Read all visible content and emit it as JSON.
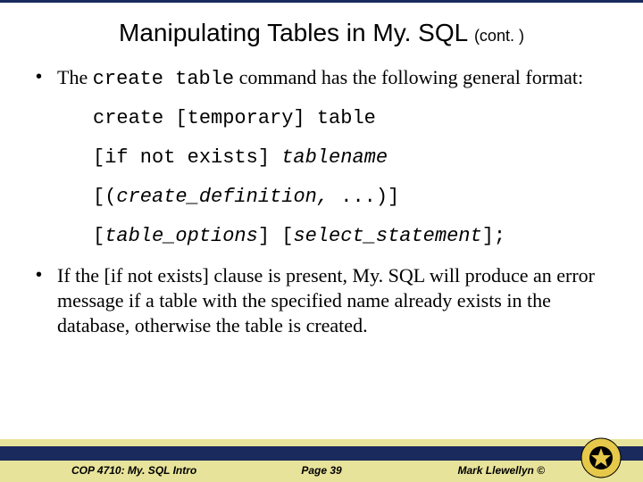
{
  "title": {
    "main": "Manipulating Tables in My. SQL ",
    "cont": "(cont. )"
  },
  "bullets": {
    "b1_pre": "The ",
    "b1_code": "create table",
    "b1_post": " command has the following general format:",
    "b2": "If the [if not exists] clause is present, My. SQL will produce an error message if a table with the specified name already exists in the database, otherwise the table is created."
  },
  "code": {
    "l1a": "create [temporary] table",
    "l2a": "[if not exists] ",
    "l2b": "tablename",
    "l3a": "[(",
    "l3b": "create_definition,",
    "l3c": " ...)]",
    "l4a": "[",
    "l4b": "table_options",
    "l4c": "]",
    "l4d": " [",
    "l4e": "select_statement",
    "l4f": "];"
  },
  "footer": {
    "left": "COP 4710: My. SQL Intro",
    "middle": "Page 39",
    "right": "Mark Llewellyn ©"
  }
}
